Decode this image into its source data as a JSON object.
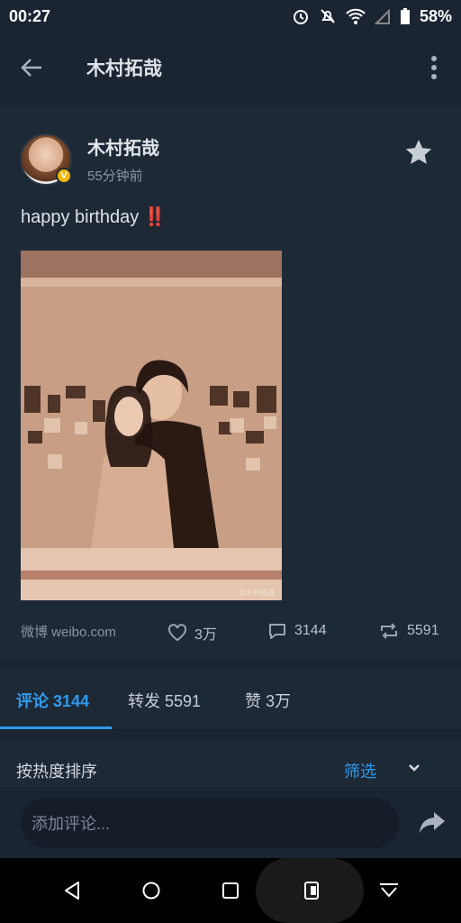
{
  "status": {
    "time": "00:27",
    "battery": "58%"
  },
  "header": {
    "title": "木村拓哉"
  },
  "post": {
    "author": "木村拓哉",
    "time_ago": "55分钟前",
    "verified_badge": "V",
    "text": "happy birthday",
    "emoji": "‼️",
    "source": "微博 weibo.com",
    "likes": "3万",
    "comments": "3144",
    "reposts": "5591",
    "image_watermark": "@木村拓哉"
  },
  "tabs": [
    {
      "label": "评论 3144"
    },
    {
      "label": "转发 5591"
    },
    {
      "label": "赞 3万"
    }
  ],
  "sort": {
    "label": "按热度排序",
    "filter": "筛选"
  },
  "comment_input": {
    "placeholder": "添加评论..."
  },
  "colors": {
    "accent": "#2f9bf0",
    "background": "#1b2532",
    "card": "#1e2936"
  }
}
